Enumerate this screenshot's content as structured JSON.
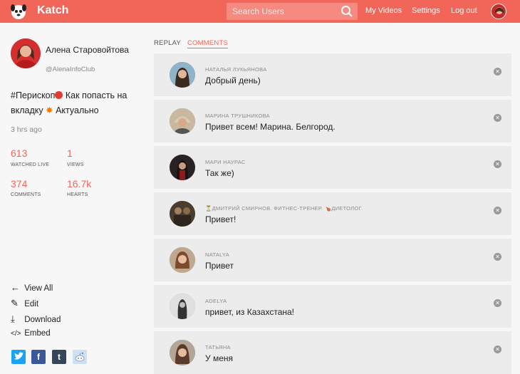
{
  "app": {
    "name": "Katch"
  },
  "search": {
    "placeholder": "Search Users"
  },
  "nav": {
    "my_videos": "My Videos",
    "settings": "Settings",
    "logout": "Log out"
  },
  "profile": {
    "name": "Алена Старовойтова",
    "handle": "@AlenaInfoClub",
    "title_part1": "#Перископ",
    "title_part2": " Как попасть на вкладку ",
    "title_part3": " Актуально",
    "time_ago": "3 hrs ago"
  },
  "stats": [
    {
      "value": "613",
      "label": "WATCHED LIVE"
    },
    {
      "value": "1",
      "label": "VIEWS"
    },
    {
      "value": "374",
      "label": "COMMENTS"
    },
    {
      "value": "16.7k",
      "label": "HEARTS"
    }
  ],
  "actions": [
    {
      "label": "View All",
      "icon": "arrow-left-icon"
    },
    {
      "label": "Edit",
      "icon": "pencil-icon"
    },
    {
      "label": "Download",
      "icon": "download-icon"
    },
    {
      "label": "Embed",
      "icon": "code-icon"
    }
  ],
  "social": [
    {
      "name": "twitter-icon",
      "glyph": "t",
      "color": "#1da1f2"
    },
    {
      "name": "facebook-icon",
      "glyph": "f",
      "color": "#3b5998"
    },
    {
      "name": "tumblr-icon",
      "glyph": "t",
      "color": "#35465c"
    },
    {
      "name": "reddit-icon",
      "glyph": "◕",
      "color": "#cfe0f2"
    }
  ],
  "tabs": {
    "replay": "REPLAY",
    "comments": "COMMENTS"
  },
  "comments": [
    {
      "user": "НАТАЛЬЯ ЛУКЬЯНОВА",
      "text": "Добрый день)"
    },
    {
      "user": "МАРИНА ТРУШНИКОВА",
      "text": "Привет всем! Марина. Белгород."
    },
    {
      "user": "МАРИ НАУРАС",
      "text": "Так же)"
    },
    {
      "user": "⏳ДМИТРИЙ СМИРНОВ. ФИТНЕС-ТРЕНЕР. 🍗ДИЕТОЛОГ.",
      "text": "Привет!"
    },
    {
      "user": "NATALYA",
      "text": "Привет"
    },
    {
      "user": "ADELYA",
      "text": "привет, из Казахстана!"
    },
    {
      "user": "ТАТЬЯНА",
      "text": "У меня"
    }
  ],
  "colors": {
    "accent": "#f2665a",
    "background": "#f7f7f7",
    "card": "#ececec"
  }
}
